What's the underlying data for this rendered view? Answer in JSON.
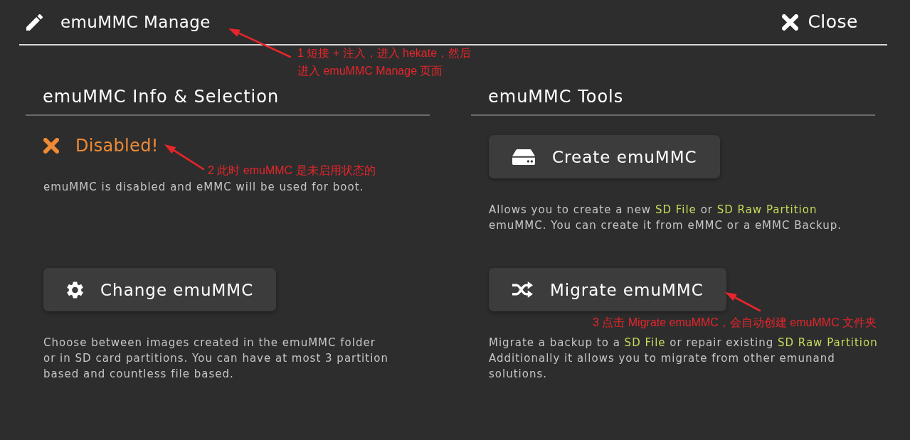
{
  "header": {
    "title": "emuMMC Manage",
    "close_label": "Close"
  },
  "sections": [
    {
      "title": "emuMMC Info & Selection",
      "status": {
        "label": "Disabled!",
        "enabled": false
      },
      "status_text": "emuMMC is disabled and eMMC will be used for boot.",
      "actions": [
        {
          "label": "Change emuMMC",
          "description": [
            {
              "text": "Choose between images created in the emuMMC folder\nor in SD card partitions. You can have at most 3 partition\nbased and countless file based.",
              "highlight": false
            }
          ]
        }
      ]
    },
    {
      "title": "emuMMC Tools",
      "actions": [
        {
          "label": "Create emuMMC",
          "description": [
            {
              "text": "Allows you to create a new ",
              "highlight": false
            },
            {
              "text": "SD File",
              "highlight": true
            },
            {
              "text": " or ",
              "highlight": false
            },
            {
              "text": "SD Raw Partition",
              "highlight": true
            },
            {
              "text": "\nemuMMC. You can create it from eMMC or a eMMC Backup.",
              "highlight": false
            }
          ]
        },
        {
          "label": "Migrate emuMMC",
          "description": [
            {
              "text": "Migrate a backup to a ",
              "highlight": false
            },
            {
              "text": "SD File",
              "highlight": true
            },
            {
              "text": " or repair existing ",
              "highlight": false
            },
            {
              "text": "SD Raw Partition",
              "highlight": true
            },
            {
              "text": "\nAdditionally it allows you to migrate from other emunand\nsolutions.",
              "highlight": false
            }
          ]
        }
      ]
    }
  ],
  "annotations": [
    {
      "lines": [
        "1 短接 + 注入，进入 hekate，然后",
        "进入 emuMMC Manage 页面"
      ]
    },
    {
      "lines": [
        "2 此时 emuMMC 是未启用状态的"
      ]
    },
    {
      "lines": [
        "3 点击 Migrate emuMMC，会自动创建 emuMMC 文件夹"
      ]
    }
  ]
}
